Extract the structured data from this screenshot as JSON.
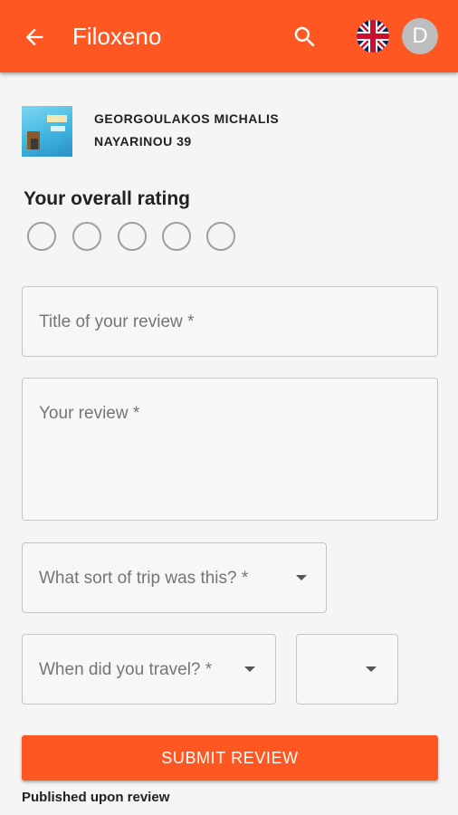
{
  "appbar": {
    "title": "Filoxeno",
    "avatar_letter": "D",
    "back_icon": "arrow-back-icon",
    "search_icon": "search-icon",
    "language_icon": "uk-flag-icon",
    "color": "#ff5722"
  },
  "listing": {
    "name": "GEORGOULAKOS MICHALIS",
    "address": "NAYARINOU 39"
  },
  "rating": {
    "label": "Your overall rating",
    "max": 5,
    "value": 0
  },
  "form": {
    "title_placeholder": "Title of your review *",
    "review_placeholder": "Your review *",
    "trip_type_placeholder": "What sort of trip was this? *",
    "travel_date_placeholder": "When did you travel? *",
    "year_value": ""
  },
  "submit": {
    "label": "SUBMIT REVIEW",
    "note": "Published upon review"
  }
}
